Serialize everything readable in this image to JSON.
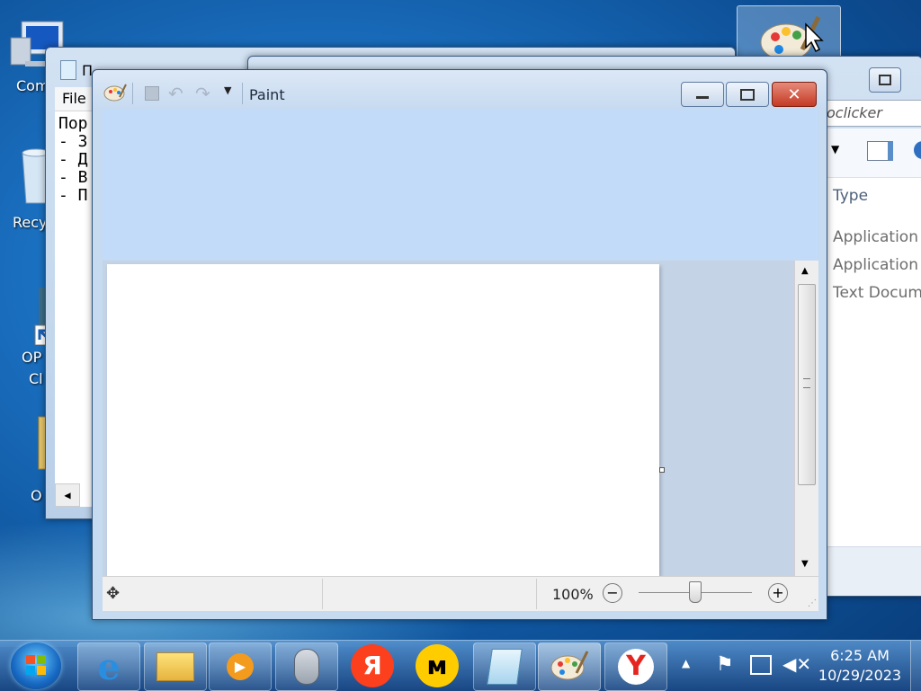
{
  "desktop": {
    "icons": [
      {
        "label": "Com",
        "icon": "computer-icon"
      },
      {
        "label": "Recy",
        "icon": "recycle-bin-icon"
      },
      {
        "label": "OP",
        "label2": "Cl",
        "icon": "shortcut-icon"
      },
      {
        "label": "O",
        "icon": "folder-icon"
      }
    ]
  },
  "notepad": {
    "title": "П",
    "menu_file": "File",
    "lines": [
      "Пор",
      "- З",
      "- Д",
      "- В",
      "- П"
    ]
  },
  "explorer": {
    "search_text": "oclicker",
    "column_type": "Type",
    "types": [
      "Application",
      "Application",
      "Text Docume"
    ]
  },
  "paint": {
    "title": "Paint",
    "zoom": "100%",
    "zoom_fraction": 0.5
  },
  "taskbar": {
    "apps": [
      "internet-explorer-icon",
      "file-explorer-icon",
      "media-player-icon",
      "opclicker-mouse-icon",
      "yandex-icon",
      "yandex-market-icon",
      "notepad-icon",
      "paint-icon",
      "yandex-browser-icon"
    ],
    "time": "6:25 AM",
    "date": "10/29/2023"
  },
  "colors": {
    "title_bg": "#c6daf0",
    "close": "#c43a24",
    "taskbar": "#1f4f8c",
    "yandex_red": "#fc3f1d",
    "market_yellow": "#ffcc00"
  }
}
